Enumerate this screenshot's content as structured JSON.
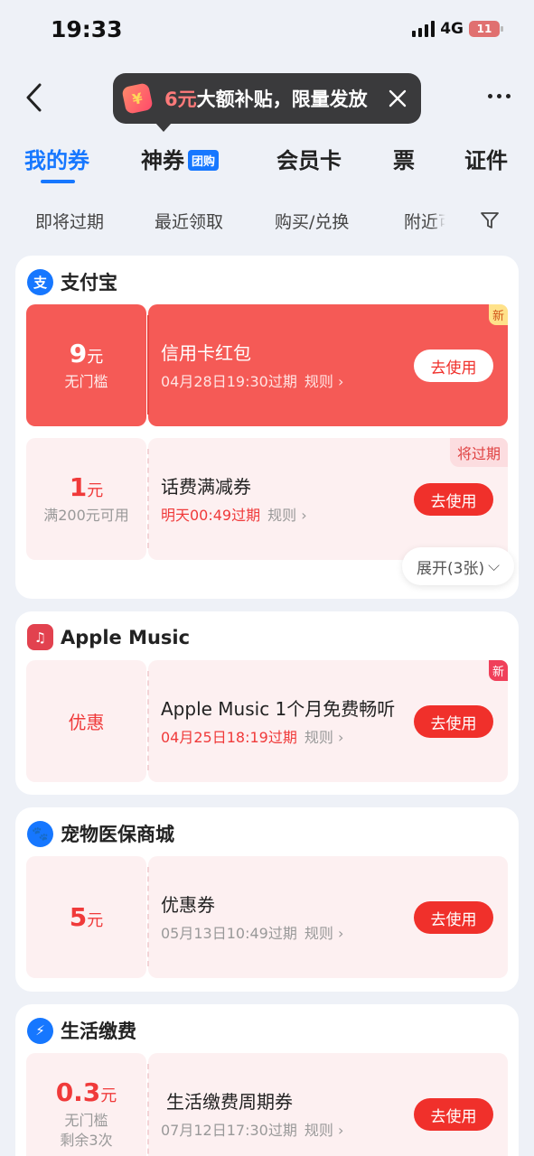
{
  "status_bar": {
    "time": "19:33",
    "network": "4G",
    "battery": "11"
  },
  "header": {
    "promo_highlight": "6元",
    "promo_text": "大额补贴，限量发放"
  },
  "tabs": [
    {
      "label": "我的券"
    },
    {
      "label": "神券",
      "badge": "团购"
    },
    {
      "label": "会员卡"
    },
    {
      "label": "票"
    },
    {
      "label": "证件"
    }
  ],
  "filters": [
    "即将过期",
    "最近领取",
    "购买/兑换",
    "附近可用"
  ],
  "colors": {
    "accent": "#1677ff",
    "coupon_red": "#f55a56",
    "button_red": "#f0302b"
  },
  "merchants": [
    {
      "name": "支付宝",
      "icon": "alipay-icon",
      "coupons": [
        {
          "amount": "9",
          "unit": "元",
          "note": "无门槛",
          "title": "信用卡红包",
          "expiry": "04月28日19:30过期",
          "rule": "规则",
          "button": "去使用",
          "tag": "新"
        },
        {
          "amount": "1",
          "unit": "元",
          "note": "满200元可用",
          "title": "话费满减券",
          "expiry": "明天00:49过期",
          "rule": "规则",
          "button": "去使用",
          "tag": "将过期"
        }
      ],
      "expand": "展开(3张)"
    },
    {
      "name": "Apple Music",
      "icon": "music-note-icon",
      "coupons": [
        {
          "amount_word": "优惠",
          "title": "Apple Music 1个月免费畅听",
          "expiry": "04月25日18:19过期",
          "rule": "规则",
          "button": "去使用",
          "tag": "新"
        }
      ]
    },
    {
      "name": "宠物医保商城",
      "icon": "pet-icon",
      "coupons": [
        {
          "amount": "5",
          "unit": "元",
          "title": "优惠券",
          "expiry": "05月13日10:49过期",
          "rule": "规则",
          "button": "去使用"
        }
      ]
    },
    {
      "name": "生活缴费",
      "icon": "lightning-icon",
      "coupons": [
        {
          "amount": "0.3",
          "unit": "元",
          "note": "无门槛",
          "note2": "剩余3次",
          "title": "生活缴费周期券",
          "expiry": "07月12日17:30过期",
          "rule": "规则",
          "button": "去使用"
        }
      ]
    }
  ]
}
